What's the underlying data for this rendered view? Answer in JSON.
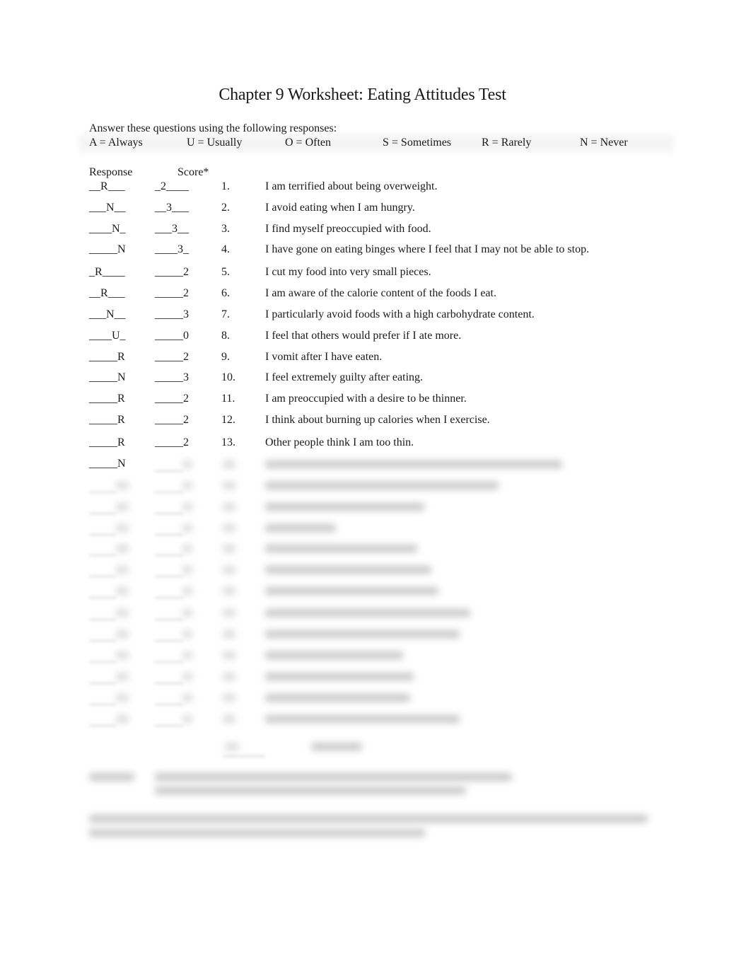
{
  "document": {
    "title": "Chapter 9 Worksheet: Eating Attitudes Test",
    "instructions": "Answer these questions using the following responses:",
    "response_key": [
      {
        "code": "A",
        "label": "A = Always"
      },
      {
        "code": "U",
        "label": "U = Usually"
      },
      {
        "code": "O",
        "label": "O = Often"
      },
      {
        "code": "S",
        "label": "S = Sometimes"
      },
      {
        "code": "R",
        "label": "R = Rarely"
      },
      {
        "code": "N",
        "label": "N = Never"
      }
    ],
    "columns": {
      "response": "Response",
      "score": "Score*"
    },
    "items": [
      {
        "response": "__R___",
        "score": "_2____",
        "number": "1.",
        "text": "I am terrified about being overweight."
      },
      {
        "response": "___N__",
        "score": "__3___",
        "number": "2.",
        "text": "I avoid eating when I am hungry."
      },
      {
        "response": "____N_",
        "score": "___3__",
        "number": "3.",
        "text": "I find myself preoccupied with food."
      },
      {
        "response": "_____N",
        "score": "____3_",
        "number": "4.",
        "text": "I have gone on eating binges where I feel that I may not be able to stop."
      },
      {
        "response": "_R____",
        "score": "_____2",
        "number": "5.",
        "text": "I cut my food into very small pieces."
      },
      {
        "response": "__R___",
        "score": "_____2",
        "number": "6.",
        "text": "I am aware of the calorie content of the foods I eat."
      },
      {
        "response": "___N__",
        "score": "_____3",
        "number": "7.",
        "text": "I particularly avoid foods with a high carbohydrate content."
      },
      {
        "response": "____U_",
        "score": "_____0",
        "number": "8.",
        "text": "I feel that others would prefer if I ate more."
      },
      {
        "response": "_____R",
        "score": "_____2",
        "number": "9.",
        "text": "I vomit after I have eaten."
      },
      {
        "response": "_____N",
        "score": "_____3",
        "number": "10.",
        "text": "I feel extremely guilty after eating."
      },
      {
        "response": "_____R",
        "score": "_____2",
        "number": "11.",
        "text": "I am preoccupied with a desire to be thinner."
      },
      {
        "response": "_____R",
        "score": "_____2",
        "number": "12.",
        "text": "I think about burning up calories when I exercise."
      },
      {
        "response": "_____R",
        "score": "_____2",
        "number": "13.",
        "text": "Other people think I am too thin."
      }
    ],
    "partial_visible_response_14": "_____N"
  }
}
